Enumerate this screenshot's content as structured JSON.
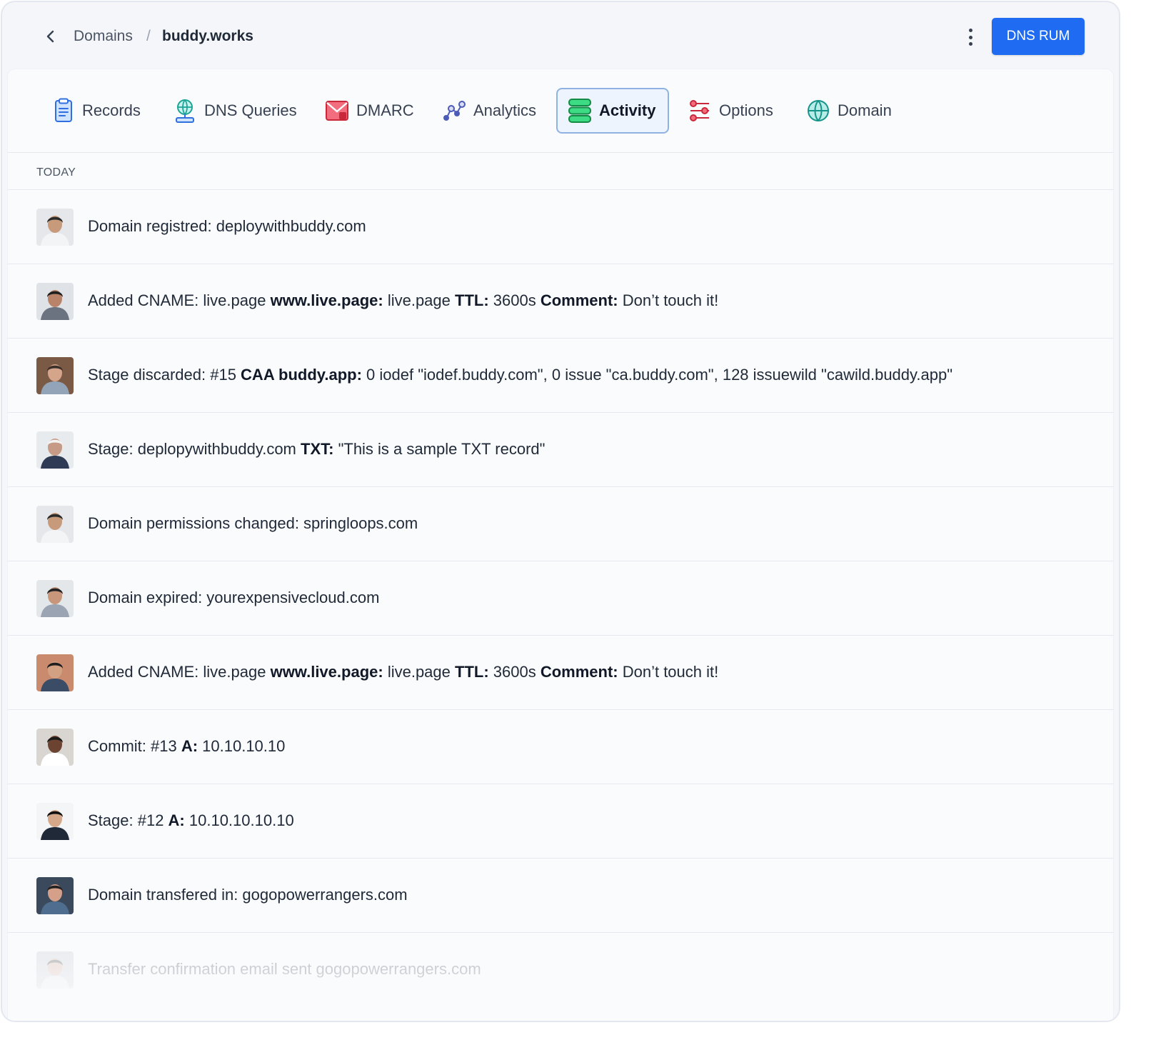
{
  "header": {
    "breadcrumb_parent": "Domains",
    "breadcrumb_separator": "/",
    "breadcrumb_current": "buddy.works",
    "primary_button": "DNS RUM"
  },
  "tabs": [
    {
      "label": "Records",
      "icon": "records-icon"
    },
    {
      "label": "DNS Queries",
      "icon": "dns-queries-icon"
    },
    {
      "label": "DMARC",
      "icon": "dmarc-icon"
    },
    {
      "label": "Analytics",
      "icon": "analytics-icon"
    },
    {
      "label": "Activity",
      "icon": "activity-icon",
      "active": true
    },
    {
      "label": "Options",
      "icon": "options-icon"
    },
    {
      "label": "Domain",
      "icon": "domain-icon"
    }
  ],
  "section": {
    "label": "TODAY"
  },
  "colors": {
    "accent": "#1f6bf2",
    "active_tab_border": "#8fb2e0",
    "active_tab_bg": "#eef4fd"
  },
  "activity": [
    {
      "parts": [
        {
          "t": "Domain registred: ",
          "b": false
        },
        {
          "t": "deploywithbuddy.com",
          "b": false
        }
      ]
    },
    {
      "parts": [
        {
          "t": "Added CNAME: live.page ",
          "b": false
        },
        {
          "t": "www.live.page:",
          "b": true
        },
        {
          "t": " live.page ",
          "b": false
        },
        {
          "t": "TTL:",
          "b": true
        },
        {
          "t": " 3600s ",
          "b": false
        },
        {
          "t": "Comment:",
          "b": true
        },
        {
          "t": " Don’t touch it!",
          "b": false
        }
      ]
    },
    {
      "parts": [
        {
          "t": "Stage discarded: #15 ",
          "b": false
        },
        {
          "t": "CAA buddy.app:",
          "b": true
        },
        {
          "t": " 0 iodef \"iodef.buddy.com\", 0 issue \"ca.buddy.com\", 128 issuewild \"cawild.buddy.app\"",
          "b": false
        }
      ]
    },
    {
      "parts": [
        {
          "t": "Stage: deplopywithbuddy.com ",
          "b": false
        },
        {
          "t": "TXT:",
          "b": true
        },
        {
          "t": " \"This is a sample TXT record\"",
          "b": false
        }
      ]
    },
    {
      "parts": [
        {
          "t": "Domain permissions changed: springloops.com",
          "b": false
        }
      ]
    },
    {
      "parts": [
        {
          "t": "Domain expired: yourexpensivecloud.com",
          "b": false
        }
      ]
    },
    {
      "parts": [
        {
          "t": "Added CNAME: live.page ",
          "b": false
        },
        {
          "t": "www.live.page:",
          "b": true
        },
        {
          "t": " live.page ",
          "b": false
        },
        {
          "t": "TTL:",
          "b": true
        },
        {
          "t": " 3600s ",
          "b": false
        },
        {
          "t": "Comment:",
          "b": true
        },
        {
          "t": " Don’t touch it!",
          "b": false
        }
      ]
    },
    {
      "parts": [
        {
          "t": "Commit: #13 ",
          "b": false
        },
        {
          "t": "A:",
          "b": true
        },
        {
          "t": " 10.10.10.10",
          "b": false
        }
      ]
    },
    {
      "parts": [
        {
          "t": "Stage: #12 ",
          "b": false
        },
        {
          "t": "A:",
          "b": true
        },
        {
          "t": " 10.10.10.10.10",
          "b": false
        }
      ]
    },
    {
      "parts": [
        {
          "t": "Domain transfered in: gogopowerrangers.com",
          "b": false
        }
      ]
    },
    {
      "parts": [
        {
          "t": "Transfer confirmation email sent gogopowerrangers.com",
          "b": false
        }
      ]
    }
  ]
}
